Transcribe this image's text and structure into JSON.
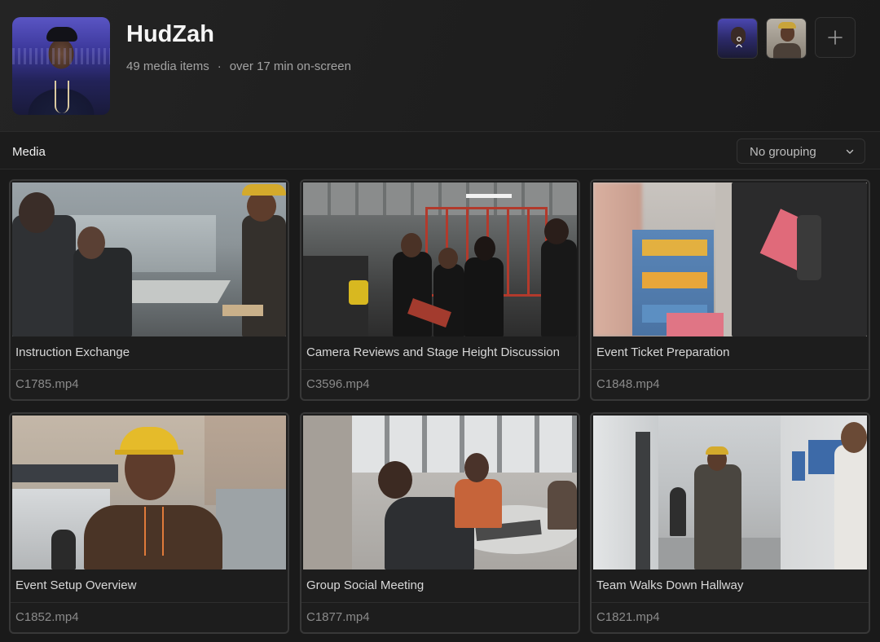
{
  "profile": {
    "name": "HudZah",
    "media_count": "49 media items",
    "separator": "·",
    "onscreen": "over 17 min on-screen"
  },
  "faces": [
    {
      "icon": "person-face-thumbnail"
    },
    {
      "icon": "person-face-thumbnail"
    }
  ],
  "add_face_label": "+",
  "toolbar": {
    "section_label": "Media",
    "grouping_value": "No grouping"
  },
  "media": [
    {
      "title": "Instruction Exchange",
      "file": "C1785.mp4"
    },
    {
      "title": "Camera Reviews and Stage Height Discussion",
      "file": "C3596.mp4"
    },
    {
      "title": "Event Ticket Preparation",
      "file": "C1848.mp4"
    },
    {
      "title": "Event Setup Overview",
      "file": "C1852.mp4"
    },
    {
      "title": "Group Social Meeting",
      "file": "C1877.mp4"
    },
    {
      "title": "Team Walks Down Hallway",
      "file": "C1821.mp4"
    }
  ],
  "colors": {
    "background": "#1a1a1a",
    "card_border": "#383838",
    "muted_text": "#8a8a8a"
  }
}
